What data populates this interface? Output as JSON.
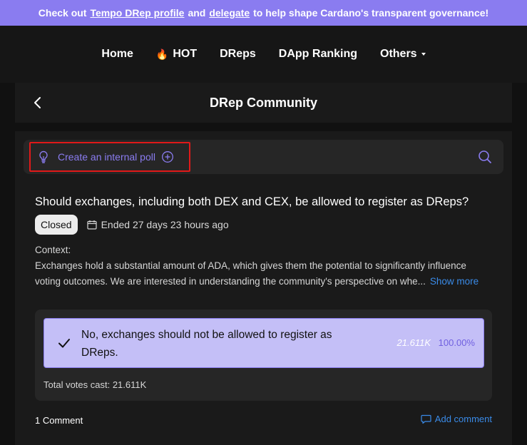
{
  "banner": {
    "prefix": "Check out",
    "link1": "Tempo DRep profile",
    "mid": "and",
    "link2": "delegate",
    "suffix": "to help shape Cardano's transparent governance!"
  },
  "nav": {
    "items": [
      {
        "label": "Home"
      },
      {
        "label": "HOT",
        "icon": "fire-icon"
      },
      {
        "label": "DReps"
      },
      {
        "label": "DApp Ranking"
      },
      {
        "label": "Others",
        "icon": "caret-down-icon"
      }
    ]
  },
  "header": {
    "title": "DRep Community",
    "back_icon": "chevron-left-icon"
  },
  "toolbar": {
    "create_poll_label": "Create an internal poll",
    "bulb_icon": "lightbulb-icon",
    "plus_icon": "plus-circle-icon",
    "search_icon": "search-icon"
  },
  "poll": {
    "title": "Should exchanges, including both DEX and CEX, be allowed to register as DReps?",
    "status": "Closed",
    "ended": "Ended 27 days 23 hours ago",
    "context_label": "Context:",
    "context_text": "Exchanges hold a substantial amount of ADA, which gives them the potential to significantly influence voting outcomes. We are interested in understanding the community's perspective on whe...",
    "show_more": "Show more",
    "options": [
      {
        "text": "No, exchanges should not be allowed to register as DReps.",
        "votes": "21.611K",
        "percent": "100.00%",
        "selected": true
      }
    ],
    "total_votes": "Total votes cast: 21.611K",
    "comment_count": "1 Comment",
    "add_comment": "Add comment"
  },
  "colors": {
    "accent": "#8a7cf0",
    "link": "#3a8be8",
    "highlight_border": "#e11919",
    "option_bg": "#c4bff7"
  }
}
